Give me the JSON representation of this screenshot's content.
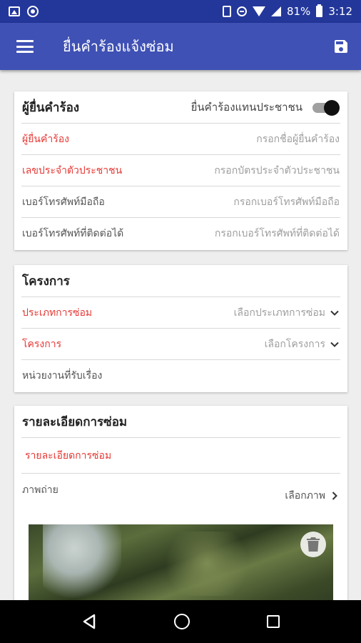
{
  "status_bar": {
    "battery": "81%",
    "time": "3:12",
    "icons": [
      "image-icon",
      "record-icon",
      "vibrate-icon",
      "dnd-icon",
      "wifi-icon",
      "signal-icon",
      "battery-icon"
    ]
  },
  "app_bar": {
    "title": "ยื่นคำร้องแจ้งซ่อม",
    "menu_icon": "hamburger-menu-icon",
    "save_icon": "save-floppy-icon"
  },
  "requester": {
    "title": "ผู้ยื่นคำร้อง",
    "toggle_label": "ยื่นคำร้องแทนประชาชน",
    "toggle_on": true,
    "rows": [
      {
        "label": "ผู้ยื่นคำร้อง",
        "placeholder": "กรอกชื่อผู้ยื่นคำร้อง",
        "required": true
      },
      {
        "label": "เลขประจำตัวประชาชน",
        "placeholder": "กรอกบัตรประจำตัวประชาชน",
        "required": true
      },
      {
        "label": "เบอร์โทรศัพท์มือถือ",
        "placeholder": "กรอกเบอร์โทรศัพท์มือถือ",
        "required": false
      },
      {
        "label": "เบอร์โทรศัพท์ที่ติดต่อได้",
        "placeholder": "กรอกเบอร์โทรศัพท์ที่ติดต่อได้",
        "required": false
      }
    ]
  },
  "project": {
    "title": "โครงการ",
    "rows": [
      {
        "label": "ประเภทการซ่อม",
        "value": "เลือกประเภทการซ่อม",
        "required": true
      },
      {
        "label": "โครงการ",
        "value": "เลือกโครงการ",
        "required": true
      },
      {
        "label": "หน่วยงานที่รับเรื่อง",
        "value": "",
        "required": false
      }
    ]
  },
  "repair": {
    "title": "รายละเอียดการซ่อม",
    "detail_label": "รายละเอียดการซ่อม",
    "photo_label": "ภาพถ่าย",
    "photo_select": "เลือกภาพ"
  },
  "colors": {
    "primary": "#3f51b5",
    "status_bar": "#23379a",
    "required": "#e53935"
  }
}
